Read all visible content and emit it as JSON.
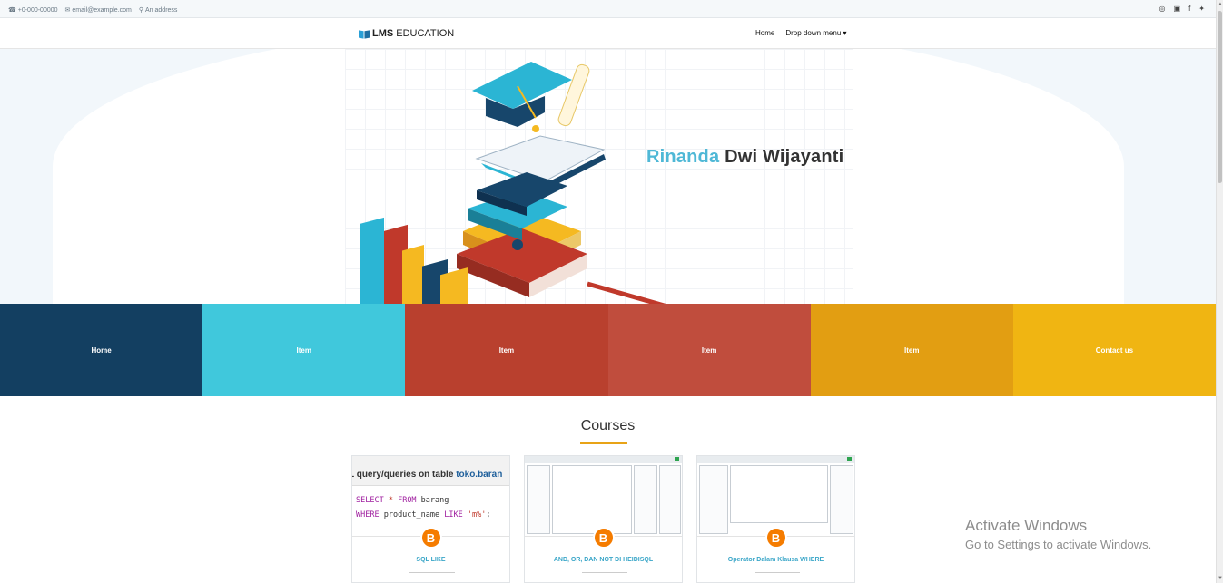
{
  "topbar": {
    "phone": "+0-000-00000",
    "email": "email@example.com",
    "address": "An address"
  },
  "brand": {
    "strong": "LMS",
    "rest": "EDUCATION"
  },
  "nav": {
    "home": "Home",
    "dropdown": "Drop down menu"
  },
  "hero": {
    "first": "Rinanda",
    "rest": "Dwi Wijayanti"
  },
  "tiles": [
    {
      "label": "Home",
      "color": "#133f61"
    },
    {
      "label": "Item",
      "color": "#40c8dc"
    },
    {
      "label": "Item",
      "color": "#b9402e"
    },
    {
      "label": "Item",
      "color": "#c04d3d"
    },
    {
      "label": "Item",
      "color": "#e29e12"
    },
    {
      "label": "Contact us",
      "color": "#f0b512"
    }
  ],
  "courses": {
    "title": "Courses",
    "cards": [
      {
        "title": "SQL LIKE",
        "thumb_head_a": "L query/queries on table ",
        "thumb_head_b": "toko.baran",
        "code1_kw": "SELECT",
        "code1_op": " * ",
        "code1_kw2": "FROM",
        "code1_rest": " barang",
        "code2_kw": "WHERE",
        "code2_mid": " product_name ",
        "code2_kw2": "LIKE",
        "code2_str": " 'm%'",
        "code2_end": ";"
      },
      {
        "title": "AND, OR, DAN NOT DI HEIDISQL"
      },
      {
        "title": "Operator Dalam Klausa WHERE"
      }
    ]
  },
  "watermark": {
    "line1": "Activate Windows",
    "line2": "Go to Settings to activate Windows."
  }
}
